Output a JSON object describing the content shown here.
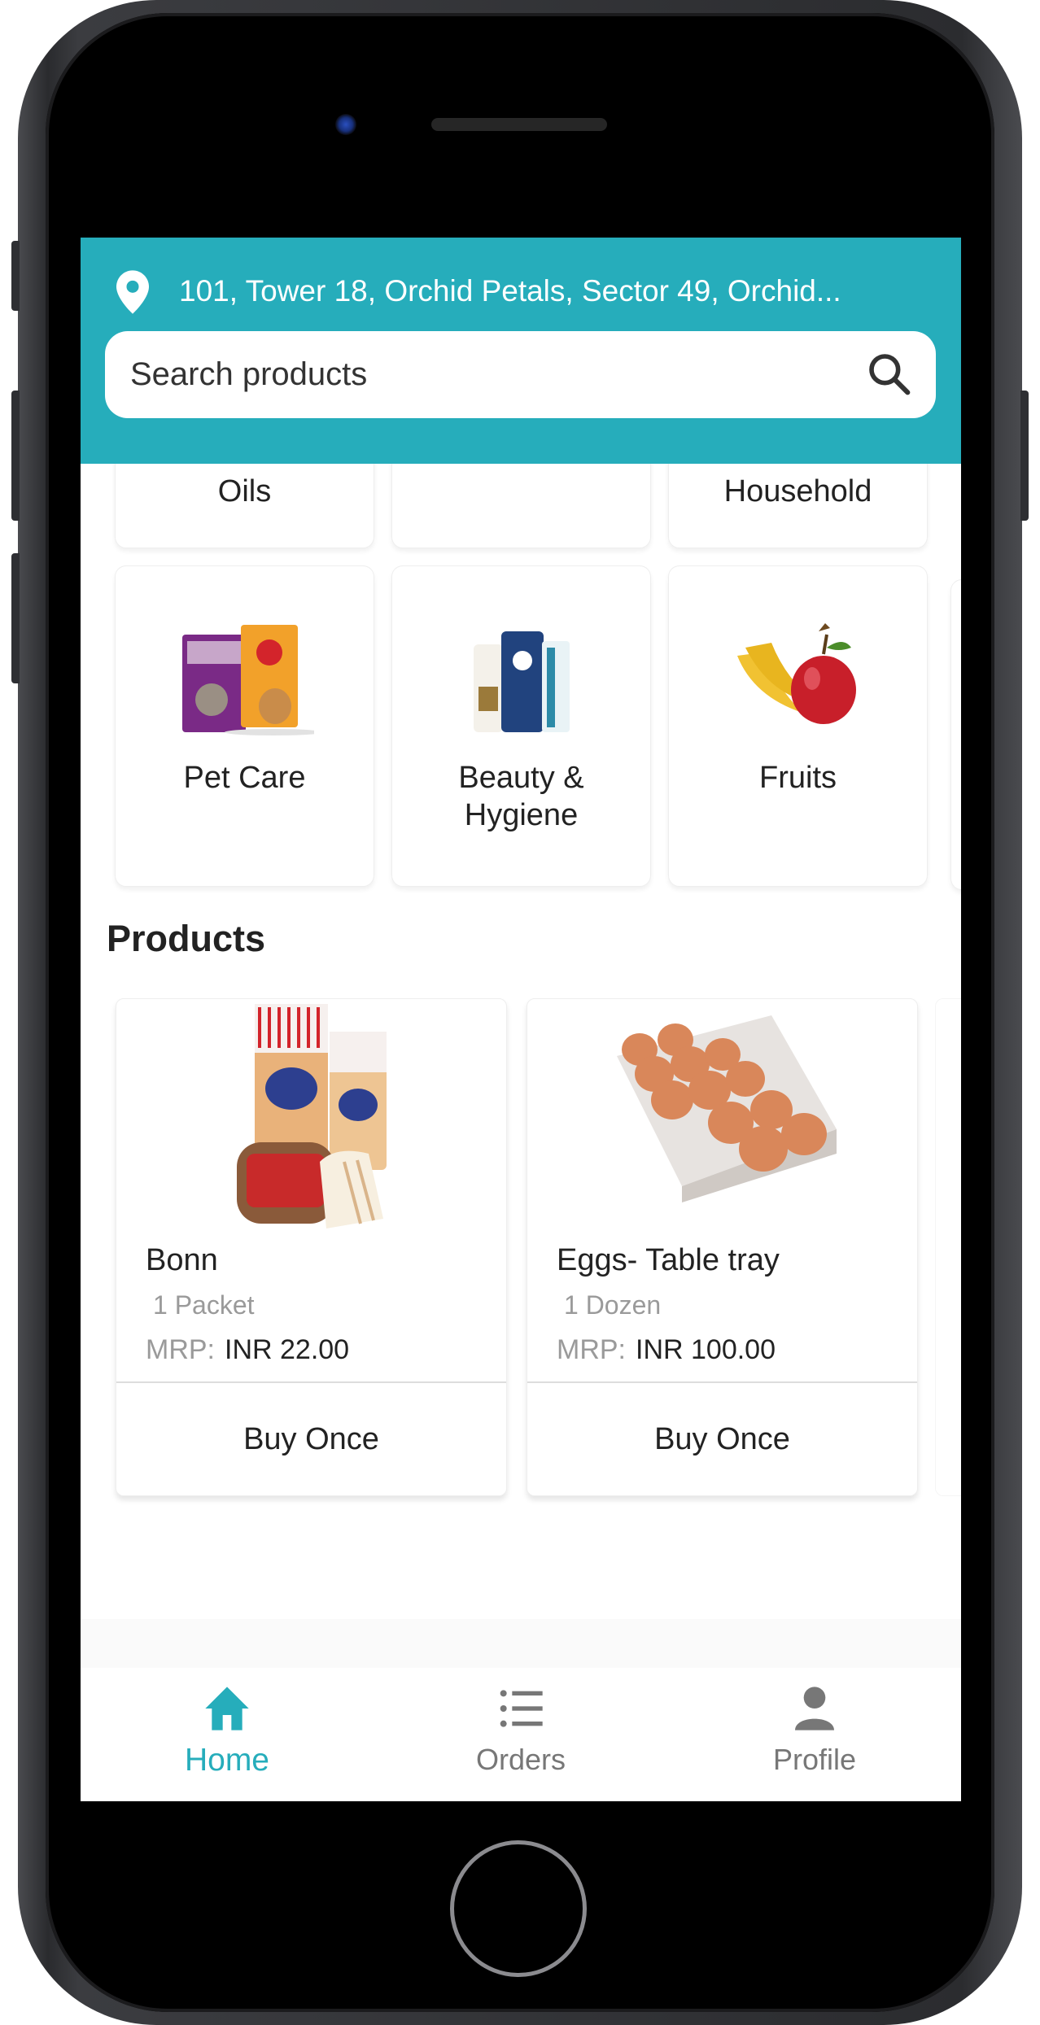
{
  "header": {
    "address": "101, Tower 18, Orchid Petals, Sector 49, Orchid...",
    "location_icon": "map-pin-icon",
    "search": {
      "placeholder": "Search products",
      "icon": "search-icon"
    },
    "accent_color": "#26adbb"
  },
  "categories": {
    "row1": [
      {
        "label": "Oils"
      },
      {
        "label": ""
      },
      {
        "label": "Household"
      }
    ],
    "row2": [
      {
        "label": "Pet Care",
        "image": "pet-food-image"
      },
      {
        "label": "Beauty & Hygiene",
        "label_line1": "Beauty &",
        "label_line2": "Hygiene",
        "image": "toiletries-image"
      },
      {
        "label": "Fruits",
        "image": "fruits-image"
      }
    ]
  },
  "products": {
    "title": "Products",
    "items": [
      {
        "name": "Bonn",
        "quantity": "1 Packet",
        "mrp_label": "MRP:",
        "price": "INR 22.00",
        "button": "Buy Once",
        "image": "bread-image"
      },
      {
        "name": "Eggs- Table tray",
        "quantity": "1 Dozen",
        "mrp_label": "MRP:",
        "price": "INR 100.00",
        "button": "Buy Once",
        "image": "eggs-image"
      }
    ]
  },
  "bottom_nav": {
    "items": [
      {
        "label": "Home",
        "icon": "home-icon",
        "active": true
      },
      {
        "label": "Orders",
        "icon": "list-icon",
        "active": false
      },
      {
        "label": "Profile",
        "icon": "person-icon",
        "active": false
      }
    ],
    "active_color": "#26adbb",
    "inactive_color": "#777777"
  }
}
